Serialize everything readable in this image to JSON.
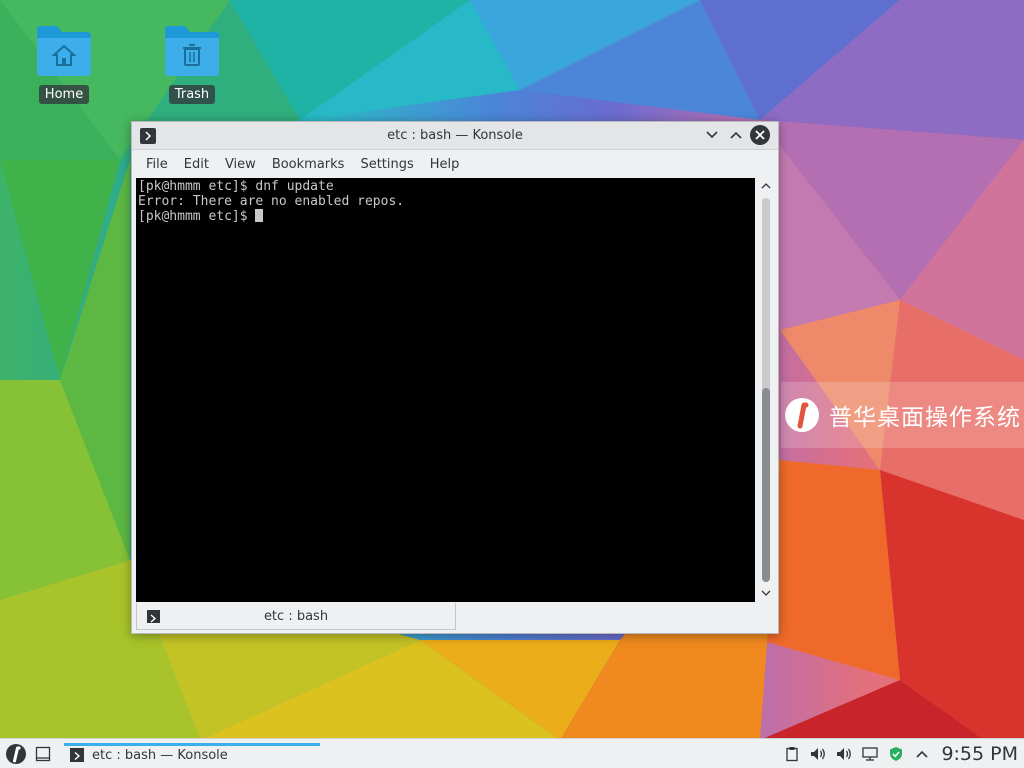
{
  "desktop": {
    "icons": [
      {
        "label": "Home",
        "icon": "home-folder-icon"
      },
      {
        "label": "Trash",
        "icon": "trash-folder-icon"
      }
    ],
    "brand_text": "普华桌面操作系统"
  },
  "window": {
    "title": "etc : bash — Konsole",
    "menu": [
      "File",
      "Edit",
      "View",
      "Bookmarks",
      "Settings",
      "Help"
    ],
    "terminal_lines": [
      "[pk@hmmm etc]$ dnf update",
      "Error: There are no enabled repos.",
      "[pk@hmmm etc]$ "
    ],
    "tab_label": "etc : bash"
  },
  "taskbar": {
    "task_label": "etc : bash — Konsole",
    "clock": "9:55 PM",
    "accent": "#3daee9"
  }
}
